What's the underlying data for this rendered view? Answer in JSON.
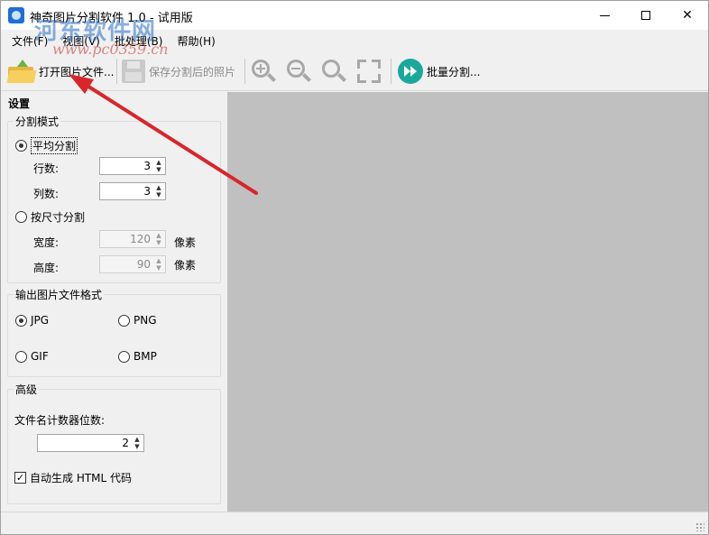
{
  "window": {
    "title": "神奇图片分割软件 1.0 - 试用版",
    "minimize_glyph": "",
    "close_glyph": "✕"
  },
  "watermark": {
    "title": "河东软件网",
    "url": "www.pc0359.cn"
  },
  "menu": [
    {
      "label": "文件(F)"
    },
    {
      "label": "视图(V)"
    },
    {
      "label": "批处理(B)"
    },
    {
      "label": "帮助(H)"
    }
  ],
  "toolbar": {
    "open_label": "打开图片文件...",
    "save_label": "保存分割后的照片",
    "batch_label": "批量分割...",
    "icons": [
      "folder-open-icon",
      "save-icon",
      "zoom-in-icon",
      "zoom-out-icon",
      "zoom-reset-icon",
      "fit-window-icon",
      "batch-split-icon"
    ]
  },
  "settings": {
    "title": "设置",
    "split_mode": {
      "legend": "分割模式",
      "average": {
        "label": "平均分割",
        "selected": true
      },
      "rows_label": "行数:",
      "rows_value": "3",
      "cols_label": "列数:",
      "cols_value": "3",
      "by_size": {
        "label": "按尺寸分割",
        "selected": false
      },
      "width_label": "宽度:",
      "width_value": "120",
      "height_label": "高度:",
      "height_value": "90",
      "unit": "像素"
    },
    "output_format": {
      "legend": "输出图片文件格式",
      "options": [
        {
          "label": "JPG",
          "selected": true
        },
        {
          "label": "PNG",
          "selected": false
        },
        {
          "label": "GIF",
          "selected": false
        },
        {
          "label": "BMP",
          "selected": false
        }
      ]
    },
    "advanced": {
      "legend": "高级",
      "digits_label": "文件名计数器位数:",
      "digits_value": "2",
      "html_checkbox": {
        "label": "自动生成 HTML 代码",
        "checked": true
      }
    }
  },
  "spin_glyphs": {
    "up": "▲",
    "down": "▼"
  },
  "colors": {
    "canvas": "#c0c0c0",
    "annotation_arrow": "#d9262b"
  }
}
